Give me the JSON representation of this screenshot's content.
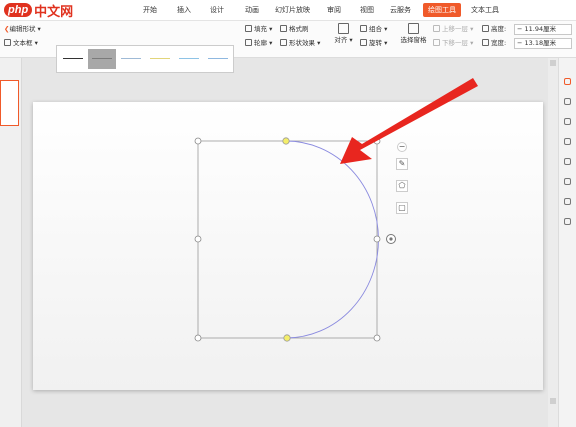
{
  "logo": {
    "brand_prefix": "php",
    "brand_name": "中文网"
  },
  "menu_tabs": [
    "开始",
    "插入",
    "设计",
    "动画",
    "幻灯片放映",
    "审阅",
    "视图",
    "云服务",
    "绘图工具",
    "文本工具"
  ],
  "active_tab": "绘图工具",
  "ribbon": {
    "edit_shape": "编辑形状",
    "text_box": "文本框",
    "fill": "填充",
    "format_painter": "格式刷",
    "outline": "轮廓",
    "shape_effects": "形状效果",
    "align": "对齐",
    "group": "组合",
    "rotate": "旋转",
    "selection_pane": "选择窗格",
    "move_up": "上移一层",
    "move_down": "下移一层",
    "height_label": "高度:",
    "height_value": "11.94厘米",
    "width_label": "宽度:",
    "width_value": "13.18厘米"
  },
  "style_gallery": {
    "swatch_colors": [
      "#333333",
      "#7a7a7a",
      "#9fbad6",
      "#e2d57a",
      "#8ec3e6",
      "#8fb8e0"
    ],
    "selected_index": 1
  },
  "colors": {
    "accent": "#f05a2a",
    "arrow": "#e8261f",
    "shape_stroke": "#8a8adf",
    "handle_yellow": "#f4ee6a"
  },
  "quick_tools": {
    "collapse": "−",
    "pen_icon": "pen-icon",
    "shape_icon": "shape-icon",
    "frame_icon": "frame-icon"
  }
}
